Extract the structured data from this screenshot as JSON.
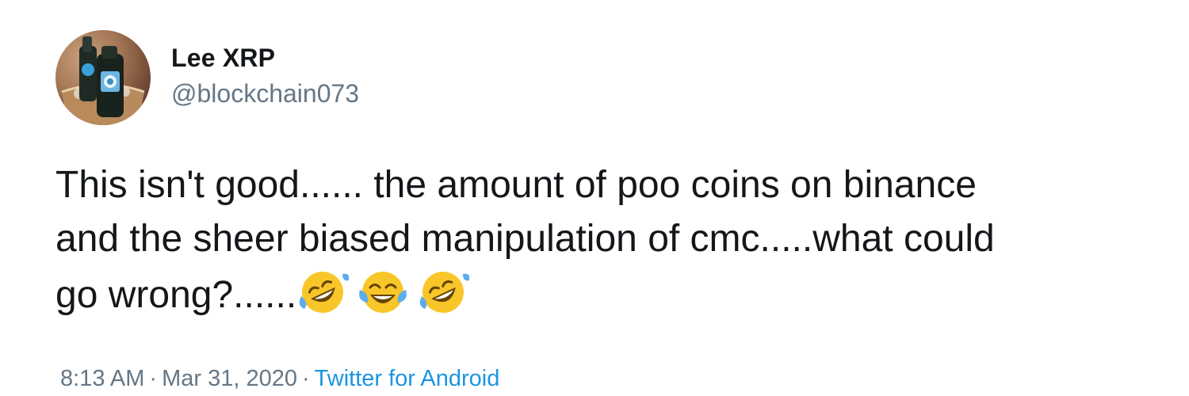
{
  "author": {
    "name": "Lee XRP",
    "handle": "@blockchain073"
  },
  "tweet": {
    "line1": "This isn't good...... the amount of poo coins on binance",
    "line2": "and the sheer biased manipulation of cmc.....what could",
    "line3": "go wrong?......",
    "emojis": [
      "rolling-on-floor-laughing-icon",
      "face-with-tears-of-joy-icon",
      "rolling-on-floor-laughing-icon"
    ]
  },
  "meta": {
    "time": "8:13 AM",
    "separator": "·",
    "date": "Mar 31, 2020",
    "source": "Twitter for Android"
  },
  "colors": {
    "text": "#14171a",
    "secondary": "#657786",
    "link": "#1b95e0"
  }
}
